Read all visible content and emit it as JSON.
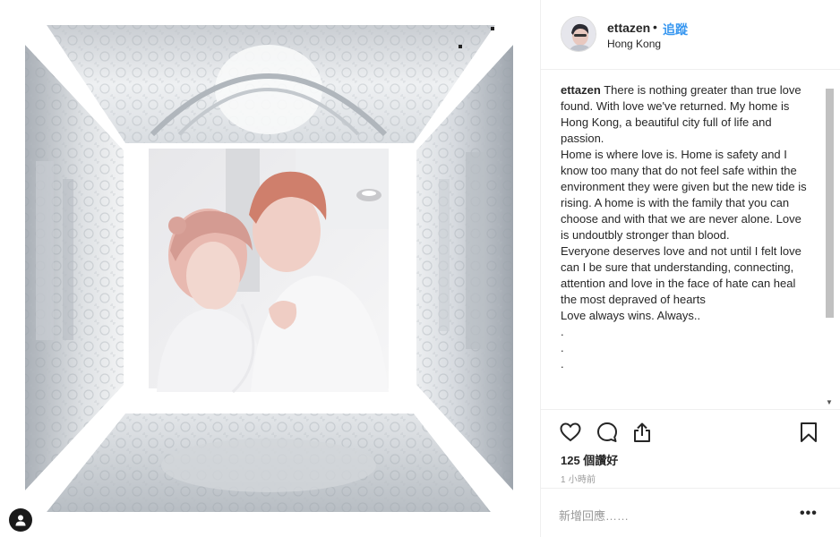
{
  "post": {
    "username": "ettazen",
    "separator": "•",
    "follow_label": "追蹤",
    "location": "Hong Kong",
    "caption_user": "ettazen",
    "caption_lines": [
      "There is nothing greater than true love found. With love we've returned. My home is Hong Kong, a beautiful city full of life and passion.",
      "Home is where love is. Home is safety and I know too many that do not feel safe within the environment they were given but the new tide is rising. A home is with the family that you can choose and with that we are never alone. Love is undoutbly stronger than blood.",
      "Everyone deserves love and not until I felt love can I be sure that understanding, connecting, attention and love in the face of hate can heal the most depraved of hearts",
      "Love always wins. Always..",
      ".",
      ".",
      "."
    ],
    "likes": "125 個讚好",
    "time": "1 小時前",
    "comment_placeholder": "新增回應……",
    "more_label": "•••"
  },
  "icons": {
    "like": "heart-icon",
    "comment": "comment-bubble-icon",
    "share": "share-upload-icon",
    "save": "bookmark-icon",
    "user_tag": "user-tag-icon"
  },
  "colors": {
    "follow": "#3897f0",
    "text": "#262626",
    "muted": "#999999",
    "border": "#efefef"
  }
}
